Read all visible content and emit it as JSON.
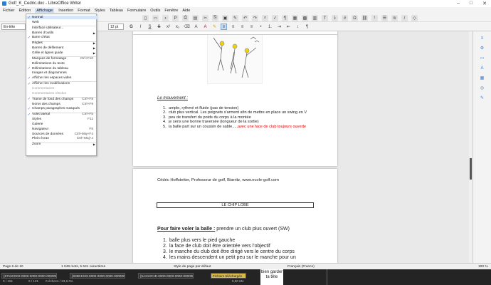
{
  "window": {
    "title": "Golf_K_Cedric.doc - LibreOffice Writer"
  },
  "menubar": {
    "items": [
      "Fichier",
      "Édition",
      "Affichage",
      "Insertion",
      "Format",
      "Styles",
      "Tableau",
      "Formulaire",
      "Outils",
      "Fenêtre",
      "Aide"
    ],
    "active_index": 2
  },
  "toolbar": {
    "style_value": "En-tête",
    "size_value": "12 pt"
  },
  "view_menu": {
    "items": [
      {
        "label": "Normal",
        "shortcut": "",
        "checked": true,
        "arrow": false,
        "disabled": false
      },
      {
        "label": "Web",
        "shortcut": "",
        "checked": false,
        "arrow": false,
        "disabled": false
      },
      {
        "label": "Interface utilisateur...",
        "shortcut": "",
        "checked": false,
        "arrow": false,
        "disabled": false
      },
      {
        "label": "Barres d'outils",
        "shortcut": "",
        "checked": false,
        "arrow": true,
        "disabled": false
      },
      {
        "label": "Barre d'état",
        "shortcut": "",
        "checked": true,
        "arrow": false,
        "disabled": false
      },
      {
        "label": "Règles",
        "shortcut": "",
        "checked": false,
        "arrow": true,
        "disabled": false
      },
      {
        "label": "Barres de défilement",
        "shortcut": "",
        "checked": false,
        "arrow": true,
        "disabled": false
      },
      {
        "label": "Grille et lignes guide",
        "shortcut": "",
        "checked": false,
        "arrow": true,
        "disabled": false
      },
      {
        "label": "Marques de formatage",
        "shortcut": "Ctrl+F10",
        "checked": false,
        "arrow": false,
        "disabled": false
      },
      {
        "label": "Délimitations du texte",
        "shortcut": "",
        "checked": false,
        "arrow": false,
        "disabled": false
      },
      {
        "label": "Délimitations du tableau",
        "shortcut": "",
        "checked": true,
        "arrow": false,
        "disabled": false
      },
      {
        "label": "Images et diagrammes",
        "shortcut": "",
        "checked": false,
        "arrow": false,
        "disabled": false
      },
      {
        "label": "Afficher les espaces vides",
        "shortcut": "",
        "checked": true,
        "arrow": false,
        "disabled": false
      },
      {
        "label": "Afficher les modifications",
        "shortcut": "",
        "checked": true,
        "arrow": false,
        "disabled": false
      },
      {
        "label": "Commentaires",
        "shortcut": "",
        "checked": false,
        "arrow": false,
        "disabled": true
      },
      {
        "label": "Commentaires résolus",
        "shortcut": "",
        "checked": false,
        "arrow": false,
        "disabled": true
      },
      {
        "label": "Trame de fond des champs",
        "shortcut": "Ctrl+F8",
        "checked": true,
        "arrow": false,
        "disabled": false
      },
      {
        "label": "Noms des champs",
        "shortcut": "Ctrl+F9",
        "checked": false,
        "arrow": false,
        "disabled": false
      },
      {
        "label": "Champs paragraphes masqués",
        "shortcut": "",
        "checked": true,
        "arrow": false,
        "disabled": false
      },
      {
        "label": "Volet latéral",
        "shortcut": "Ctrl+F5",
        "checked": true,
        "arrow": false,
        "disabled": false
      },
      {
        "label": "Styles",
        "shortcut": "F11",
        "checked": false,
        "arrow": false,
        "disabled": false
      },
      {
        "label": "Galerie",
        "shortcut": "",
        "checked": false,
        "arrow": false,
        "disabled": false
      },
      {
        "label": "Navigateur",
        "shortcut": "F5",
        "checked": false,
        "arrow": false,
        "disabled": false
      },
      {
        "label": "Sources de données",
        "shortcut": "Ctrl+Maj+F4",
        "checked": false,
        "arrow": false,
        "disabled": false
      },
      {
        "label": "Plein écran",
        "shortcut": "Ctrl+Maj+J",
        "checked": false,
        "arrow": false,
        "disabled": false
      },
      {
        "label": "Zoom",
        "shortcut": "",
        "checked": false,
        "arrow": true,
        "disabled": false
      }
    ]
  },
  "page1": {
    "heading": "Le mouvement :",
    "list": [
      {
        "num": "1.",
        "text": "ample, rythmé et fluide (pas de tension)",
        "red": ""
      },
      {
        "num": "2.",
        "text": "club plus vertical. Les poignets s'arment afin de mettre en place un swing en V",
        "red": ""
      },
      {
        "num": "3.",
        "text": "peu de transfert du poids du corps à la montée",
        "red": ""
      },
      {
        "num": "4.",
        "text": "je sens une bonne traversée (longueur de la sortie)",
        "red": ""
      },
      {
        "num": "5.",
        "text": "la balle part sur un coussin de sable.....",
        "red": "avec une face de club toujours ouverte"
      }
    ]
  },
  "page2": {
    "author_line": "Cédric Hoffstetter, Professeur de golf, Biarritz, www.ecole-golf.com",
    "box_title": "LE CHIP LOBE",
    "heading_bold": "Pour faire voler la balle :",
    "heading_rest": " prendre un club plus ouvert (SW)",
    "list": [
      {
        "num": "1.",
        "text": "balle plus vers le pied gauche"
      },
      {
        "num": "2.",
        "text": "la face de club doit être orientée vers l'objectif"
      },
      {
        "num": "3.",
        "text": "le manche du club doit être dirigé vers le centre du corps"
      },
      {
        "num": "4.",
        "text": "les mains descendent un petit peu sur le manche pour un"
      }
    ]
  },
  "statusbar": {
    "page": "Page 6 de 10",
    "words": "1 049 mots, 5 641 caractères",
    "style": "Style de page par défaut",
    "language": "Français (France)",
    "zoom": "100 %"
  },
  "taskbar": {
    "items": [
      "{6716CD02-0000-0000-0000-000000000000}",
      "{836E1033-0000-0000-0000-000000000000}",
      "{5A213C1E-0000-0000-0000-000000000000}"
    ],
    "folder": "Fichiers téléchargés",
    "status_left": "0 / 151",
    "status_mid": "0 / 121",
    "status_mid2": "0 échecs / 23,6 Go",
    "size": "5,90 Mo",
    "sticky_note": "bien garder ta tête"
  }
}
